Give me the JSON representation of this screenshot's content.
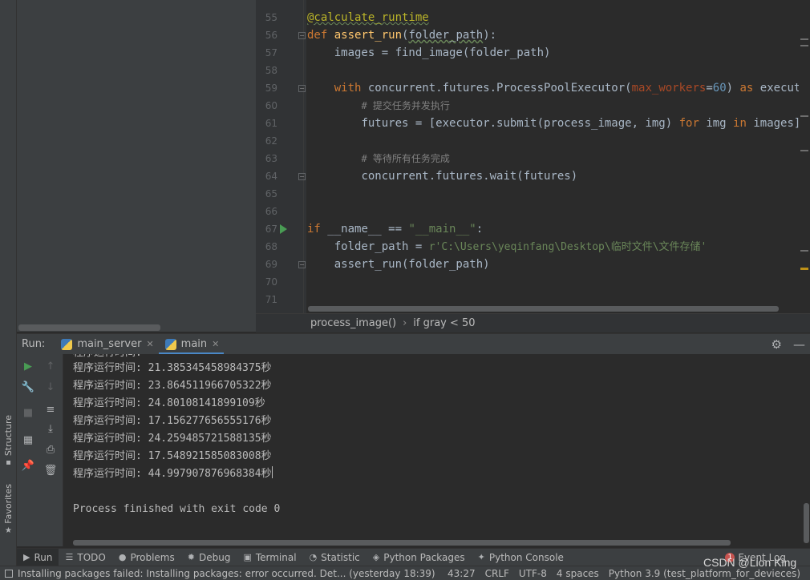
{
  "sidebar": {
    "structure_label": "Structure",
    "favorites_label": "Favorites"
  },
  "editor": {
    "lines": [
      {
        "n": "55"
      },
      {
        "n": "56"
      },
      {
        "n": "57"
      },
      {
        "n": "58"
      },
      {
        "n": "59"
      },
      {
        "n": "60"
      },
      {
        "n": "61"
      },
      {
        "n": "62"
      },
      {
        "n": "63"
      },
      {
        "n": "64"
      },
      {
        "n": "65"
      },
      {
        "n": "66"
      },
      {
        "n": "67"
      },
      {
        "n": "68"
      },
      {
        "n": "69"
      },
      {
        "n": "70"
      },
      {
        "n": "71"
      }
    ],
    "code": {
      "l55_decorator": "@calculate_runtime",
      "l56_def": "def",
      "l56_name": "assert_run",
      "l56_params": "folder_path",
      "l57": "images = find_image(folder_path)",
      "l59_with": "with",
      "l59_mid": "concurrent.futures.ProcessPoolExecutor(",
      "l59_kw": "max_workers",
      "l59_num": "60",
      "l59_as": "as",
      "l59_end": "executor:",
      "l60": "# 提交任务并发执行",
      "l61_a": "futures = [executor.submit(process_image, img) ",
      "l61_for": "for",
      "l61_b": " img ",
      "l61_in": "in",
      "l61_c": " images]",
      "l63": "# 等待所有任务完成",
      "l64": "concurrent.futures.wait(futures)",
      "l67_if": "if",
      "l67_name": "__name__",
      "l67_eq": " == ",
      "l67_str": "\"__main__\"",
      "l68_a": "folder_path = ",
      "l68_str": "r'C:\\Users\\yeqinfang\\Desktop\\临时文件\\文件存储'",
      "l69": "assert_run(folder_path)"
    }
  },
  "breadcrumb": {
    "item1": "process_image()",
    "item2": "if gray < 50"
  },
  "run": {
    "label": "Run:",
    "tabs": [
      {
        "label": "main_server"
      },
      {
        "label": "main"
      }
    ],
    "console": {
      "partial_top": "程序运行时间:",
      "lines": [
        "程序运行时间: 21.385345458984375秒",
        "程序运行时间: 23.864511966705322秒",
        "程序运行时间: 24.80108141899109秒",
        "程序运行时间: 17.156277656555176秒",
        "程序运行时间: 24.259485721588135秒",
        "程序运行时间: 17.548921585083008秒",
        "程序运行时间: 44.997907876968384秒"
      ],
      "exit": "Process finished with exit code 0"
    }
  },
  "bottom_tabs": {
    "run": "Run",
    "todo": "TODO",
    "problems": "Problems",
    "debug": "Debug",
    "terminal": "Terminal",
    "statistic": "Statistic",
    "python_packages": "Python Packages",
    "python_console": "Python Console",
    "event_log": "Event Log",
    "event_count": "1"
  },
  "status": {
    "message": "Installing packages failed: Installing packages: error occurred. Det... (yesterday 18:39)",
    "position": "43:27",
    "line_sep": "CRLF",
    "encoding": "UTF-8",
    "indent": "4 spaces",
    "interpreter": "Python 3.9 (test_platform_for_devieces)"
  },
  "watermark": "CSDN @Lion King"
}
